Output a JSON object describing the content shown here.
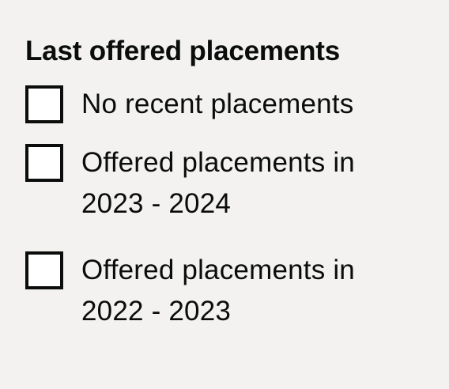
{
  "filter": {
    "legend": "Last offered placements",
    "options": [
      {
        "label": "No recent placements",
        "checked": false
      },
      {
        "label": "Offered placements in 2023 - 2024",
        "checked": false
      },
      {
        "label": "Offered placements in 2022 - 2023",
        "checked": false
      }
    ]
  }
}
